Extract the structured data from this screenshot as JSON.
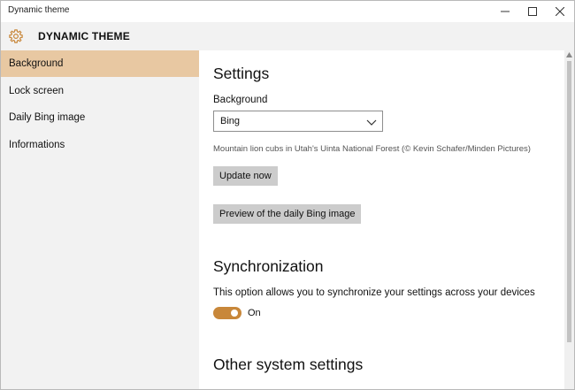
{
  "window": {
    "title": "Dynamic theme"
  },
  "header": {
    "icon": "gear-icon",
    "title": "DYNAMIC THEME"
  },
  "sidebar": {
    "items": [
      {
        "label": "Background",
        "active": true
      },
      {
        "label": "Lock screen",
        "active": false
      },
      {
        "label": "Daily Bing image",
        "active": false
      },
      {
        "label": "Informations",
        "active": false
      }
    ]
  },
  "settings": {
    "heading": "Settings",
    "background_label": "Background",
    "background_value": "Bing",
    "image_caption": "Mountain lion cubs in Utah's Uinta National Forest (© Kevin Schafer/Minden Pictures)",
    "update_button": "Update now",
    "preview_button": "Preview of the daily Bing image"
  },
  "sync": {
    "heading": "Synchronization",
    "description": "This option allows you to synchronize your settings across your devices",
    "toggle_on": true,
    "toggle_label": "On"
  },
  "other": {
    "heading": "Other system settings"
  },
  "colors": {
    "accent": "#c8873a",
    "active_nav": "#e8c8a2",
    "sidebar_bg": "#f2f2f2",
    "button_bg": "#cccccc"
  }
}
